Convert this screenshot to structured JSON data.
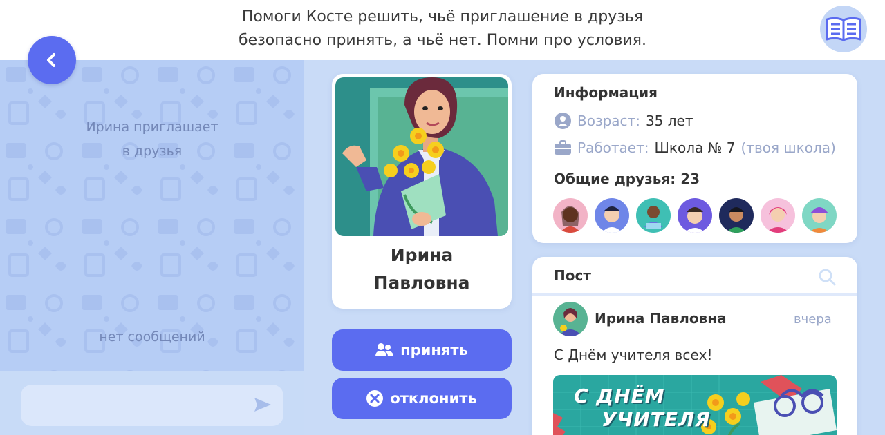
{
  "header": {
    "task_line1": "Помоги Косте решить, чьё приглашение в друзья",
    "task_line2": "безопасно принять, а чьё нет. Помни про условия.",
    "book_icon": "book-icon",
    "back_icon": "chevron-left-icon"
  },
  "chat": {
    "invite_line1": "Ирина приглашает",
    "invite_line2": "в друзья",
    "empty_text": "нет сообщений",
    "input_value": "",
    "send_icon": "send-icon"
  },
  "profile": {
    "first_name": "Ирина",
    "last_name": "Павловна",
    "accept_label": "принять",
    "decline_label": "отклонить"
  },
  "info": {
    "title": "Информация",
    "age_label": "Возраст:",
    "age_value": "35 лет",
    "work_label": "Работает:",
    "work_value": "Школа № 7",
    "work_note": "(твоя школа)",
    "friends_title": "Общие друзья: 23"
  },
  "post": {
    "title": "Пост",
    "author": "Ирина Павловна",
    "time": "вчера",
    "text": "С Днём учителя всех!",
    "image_line1": "С ДНЁМ",
    "image_line2": "УЧИТЕЛЯ"
  },
  "colors": {
    "accent": "#5b6cf0",
    "panel": "#b6cdf5",
    "background": "#c9dbf7",
    "muted": "#9aa7c9"
  }
}
